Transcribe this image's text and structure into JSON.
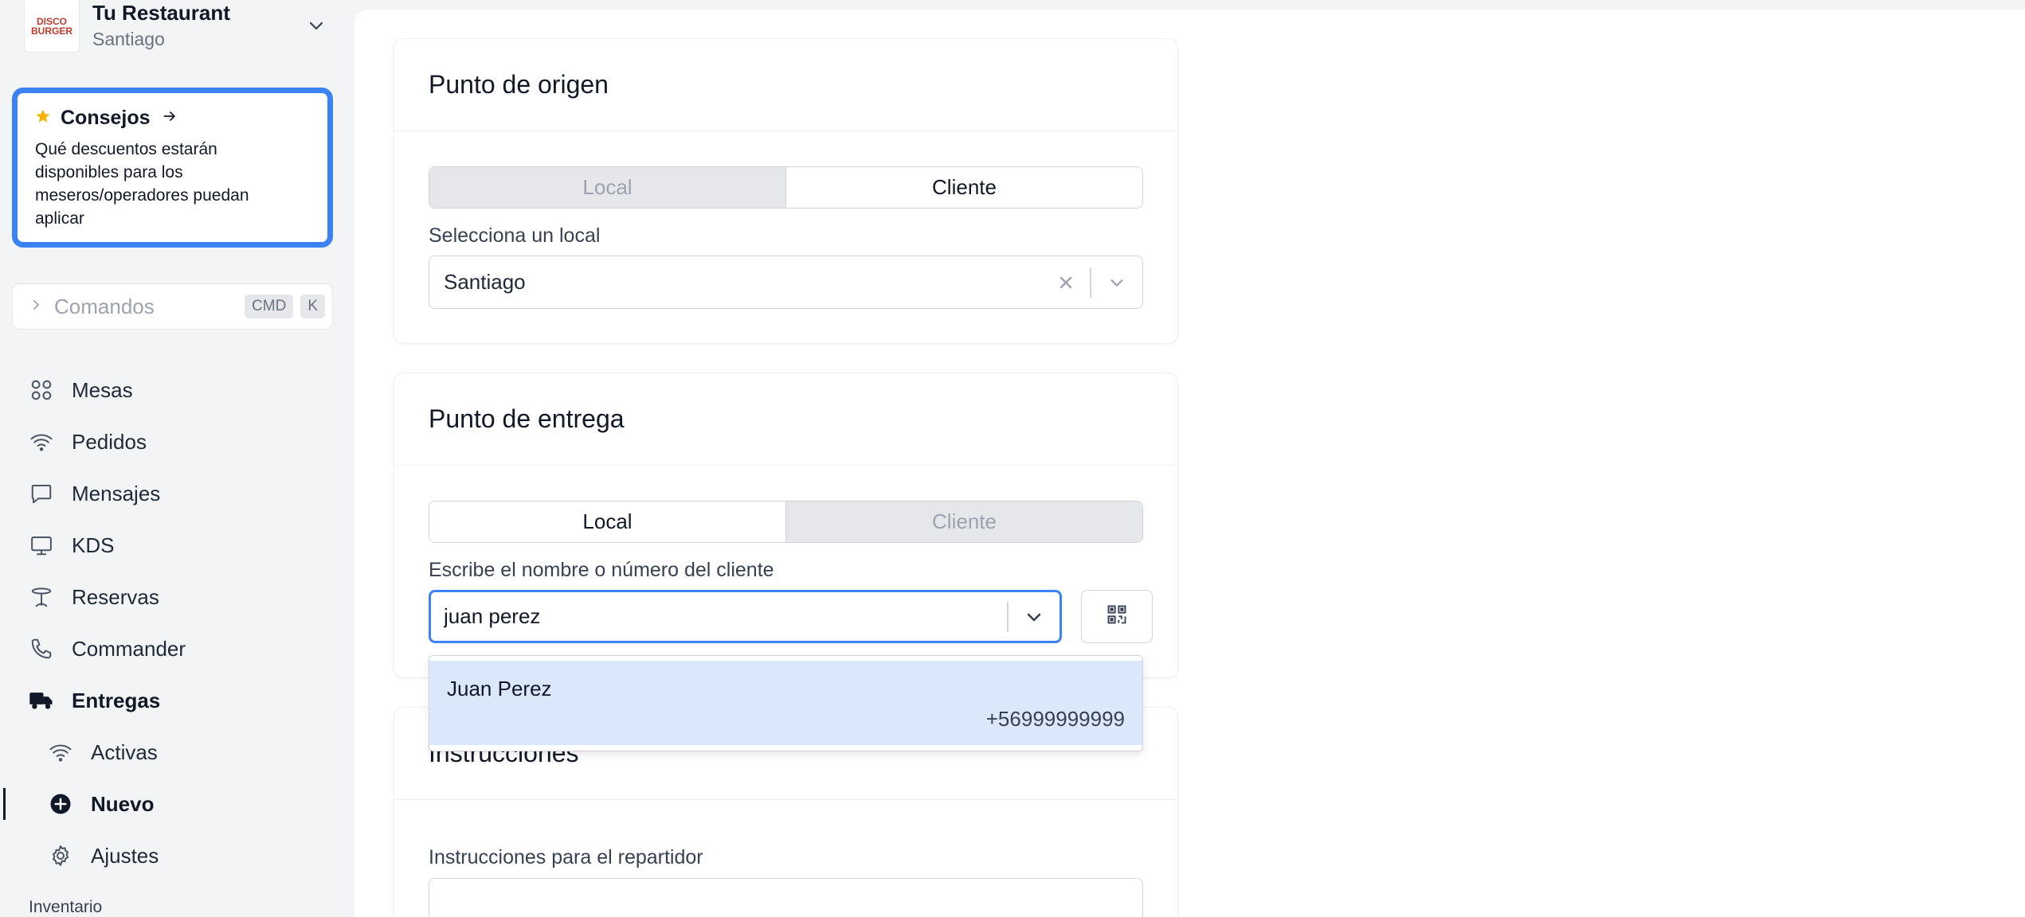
{
  "sidebar": {
    "restaurant": {
      "logo_text": "DISCO BURGER",
      "name": "Tu Restaurant",
      "city": "Santiago"
    },
    "tips": {
      "title": "Consejos",
      "body": "Qué descuentos estarán disponibles para los meseros/operadores puedan aplicar"
    },
    "commands": {
      "label": "Comandos",
      "key1": "CMD",
      "key2": "K"
    },
    "nav": [
      {
        "label": "Mesas",
        "icon": "grid-icon"
      },
      {
        "label": "Pedidos",
        "icon": "wifi-icon"
      },
      {
        "label": "Mensajes",
        "icon": "chat-icon"
      },
      {
        "label": "KDS",
        "icon": "monitor-icon"
      },
      {
        "label": "Reservas",
        "icon": "table-icon"
      },
      {
        "label": "Commander",
        "icon": "phone-icon"
      },
      {
        "label": "Entregas",
        "icon": "truck-icon"
      }
    ],
    "subnav": [
      {
        "label": "Activas",
        "icon": "wifi-icon"
      },
      {
        "label": "Nuevo",
        "icon": "plus-circle-icon"
      },
      {
        "label": "Ajustes",
        "icon": "gear-icon"
      }
    ],
    "section_label": "Inventario"
  },
  "origin": {
    "title": "Punto de origen",
    "toggle": {
      "left": "Local",
      "right": "Cliente",
      "selected": "Cliente"
    },
    "select_label": "Selecciona un local",
    "select_value": "Santiago"
  },
  "delivery": {
    "title": "Punto de entrega",
    "toggle": {
      "left": "Local",
      "right": "Cliente",
      "selected": "Local"
    },
    "search_label": "Escribe el nombre o número del cliente",
    "search_value": "juan perez",
    "results": [
      {
        "name": "Juan Perez",
        "phone": "+56999999999"
      }
    ]
  },
  "instructions": {
    "title": "Instrucciones",
    "field_label": "Instrucciones para el repartidor"
  },
  "colors": {
    "accent": "#3b82f6",
    "highlight": "#dbe8fb",
    "star": "#f5b400"
  }
}
